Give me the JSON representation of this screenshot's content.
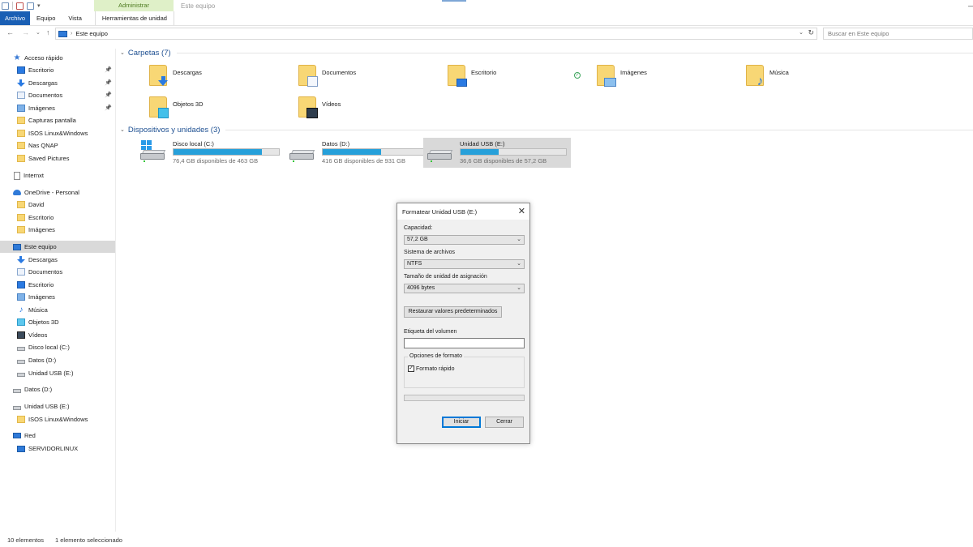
{
  "window": {
    "title": "Este equipo",
    "context_tab_group": "Administrar"
  },
  "ribbon": {
    "tabs": [
      "Archivo",
      "Equipo",
      "Vista",
      "Herramientas de unidad"
    ]
  },
  "address": {
    "path": "Este equipo",
    "search_placeholder": "Buscar en Este equipo"
  },
  "sidebar": {
    "items": [
      {
        "label": "Acceso rápido",
        "icon": "star-icon",
        "pinned": false
      },
      {
        "label": "Escritorio",
        "icon": "desktop-icon",
        "pinned": true
      },
      {
        "label": "Descargas",
        "icon": "download-icon",
        "pinned": true
      },
      {
        "label": "Documentos",
        "icon": "documents-icon",
        "pinned": true
      },
      {
        "label": "Imágenes",
        "icon": "pictures-icon",
        "pinned": true
      },
      {
        "label": "Capturas pantalla",
        "icon": "folder-icon",
        "pinned": false
      },
      {
        "label": "ISOS Linux&Windows",
        "icon": "folder-icon",
        "pinned": false
      },
      {
        "label": "Nas QNAP",
        "icon": "folder-icon",
        "pinned": false
      },
      {
        "label": "Saved Pictures",
        "icon": "folder-icon",
        "pinned": false
      },
      {
        "label": "Internxt",
        "icon": "file-icon",
        "pinned": false
      },
      {
        "label": "OneDrive - Personal",
        "icon": "cloud-icon",
        "pinned": false
      },
      {
        "label": "David",
        "icon": "folder-icon",
        "pinned": false
      },
      {
        "label": "Escritorio",
        "icon": "folder-icon",
        "pinned": false
      },
      {
        "label": "Imágenes",
        "icon": "folder-icon",
        "pinned": false
      },
      {
        "label": "Este equipo",
        "icon": "computer-icon",
        "pinned": false,
        "selected": true
      },
      {
        "label": "Descargas",
        "icon": "download-icon",
        "pinned": false
      },
      {
        "label": "Documentos",
        "icon": "documents-icon",
        "pinned": false
      },
      {
        "label": "Escritorio",
        "icon": "desktop-icon",
        "pinned": false
      },
      {
        "label": "Imágenes",
        "icon": "pictures-icon",
        "pinned": false
      },
      {
        "label": "Música",
        "icon": "music-icon",
        "pinned": false
      },
      {
        "label": "Objetos 3D",
        "icon": "objects-3d-icon",
        "pinned": false
      },
      {
        "label": "Vídeos",
        "icon": "videos-icon",
        "pinned": false
      },
      {
        "label": "Disco local (C:)",
        "icon": "drive-icon",
        "pinned": false
      },
      {
        "label": "Datos (D:)",
        "icon": "drive-icon",
        "pinned": false
      },
      {
        "label": "Unidad USB (E:)",
        "icon": "drive-icon",
        "pinned": false
      },
      {
        "label": "Datos (D:)",
        "icon": "drive-icon",
        "pinned": false
      },
      {
        "label": "Unidad USB (E:)",
        "icon": "drive-icon",
        "pinned": false
      },
      {
        "label": "ISOS Linux&Windows",
        "icon": "folder-icon",
        "pinned": false
      },
      {
        "label": "Red",
        "icon": "network-icon",
        "pinned": false
      },
      {
        "label": "SERVIDORLINUX",
        "icon": "computer-icon",
        "pinned": false
      }
    ]
  },
  "folders_group": {
    "title": "Carpetas (7)",
    "items": [
      {
        "label": "Descargas",
        "icon": "download-folder-icon"
      },
      {
        "label": "Documentos",
        "icon": "documents-folder-icon"
      },
      {
        "label": "Escritorio",
        "icon": "desktop-folder-icon"
      },
      {
        "label": "Imágenes",
        "icon": "pictures-folder-icon"
      },
      {
        "label": "Música",
        "icon": "music-folder-icon"
      },
      {
        "label": "Objetos 3D",
        "icon": "objects-3d-folder-icon"
      },
      {
        "label": "Vídeos",
        "icon": "videos-folder-icon"
      }
    ]
  },
  "drives_group": {
    "title": "Dispositivos y unidades (3)",
    "items": [
      {
        "label": "Disco local (C:)",
        "free_text": "76,4 GB disponibles de 463 GB",
        "used_fraction": 0.835
      },
      {
        "label": "Datos (D:)",
        "free_text": "416 GB disponibles de 931 GB",
        "used_fraction": 0.553
      },
      {
        "label": "Unidad USB (E:)",
        "free_text": "36,6 GB disponibles de 57,2 GB",
        "used_fraction": 0.36,
        "selected": true
      }
    ]
  },
  "format_dialog": {
    "title": "Formatear Unidad USB (E:)",
    "capacity_label": "Capacidad:",
    "capacity_value": "57,2 GB",
    "filesystem_label": "Sistema de archivos",
    "filesystem_value": "NTFS",
    "allocation_label": "Tamaño de unidad de asignación",
    "allocation_value": "4096 bytes",
    "restore_button": "Restaurar valores predeterminados",
    "volume_label": "Etiqueta del volumen",
    "volume_value": "",
    "options_legend": "Opciones de formato",
    "quick_format_label": "Formato rápido",
    "quick_format_checked": true,
    "progress": 0,
    "start_button": "Iniciar",
    "close_button": "Cerrar"
  },
  "status": {
    "item_count": "10 elementos",
    "selection": "1 elemento seleccionado"
  }
}
